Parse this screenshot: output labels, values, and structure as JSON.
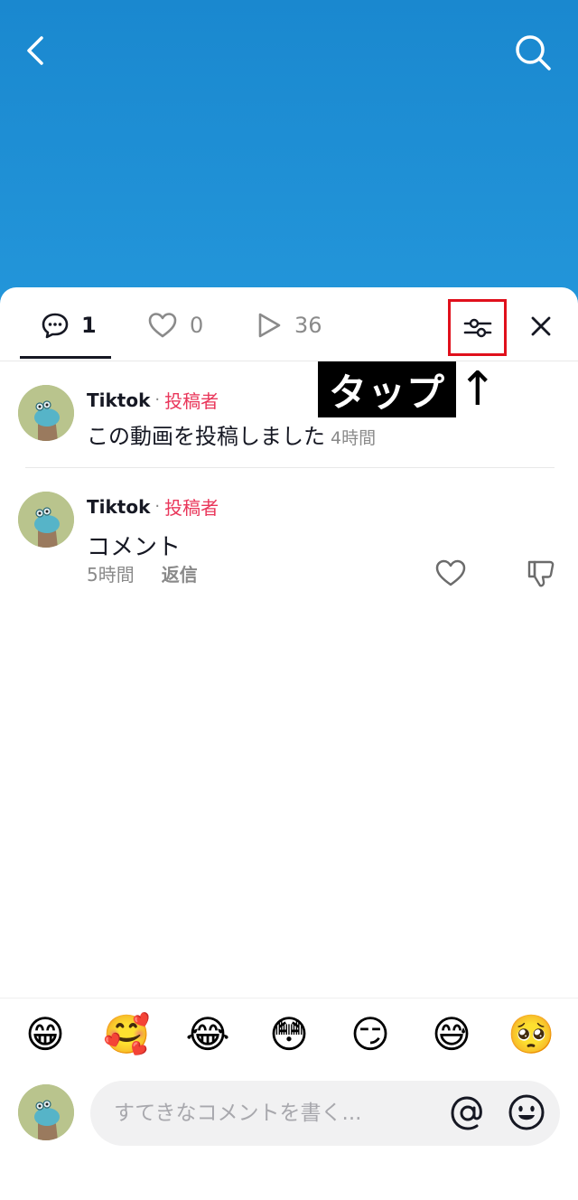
{
  "header": {
    "back_icon": "chevron-left-icon",
    "search_icon": "search-icon"
  },
  "tabs": [
    {
      "icon": "comment-icon",
      "count": "1",
      "active": true
    },
    {
      "icon": "heart-icon",
      "count": "0",
      "active": false
    },
    {
      "icon": "play-icon",
      "count": "36",
      "active": false
    }
  ],
  "toolbar": {
    "filter_icon": "sliders-icon",
    "close_icon": "close-icon"
  },
  "annotation": {
    "label": "タップ",
    "arrow": "↑"
  },
  "comments": [
    {
      "username": "Tiktok",
      "badge": "投稿者",
      "text": "この動画を投稿しました",
      "time": "4時間"
    },
    {
      "username": "Tiktok",
      "badge": "投稿者",
      "text": "コメント",
      "time": "5時間",
      "reply_label": "返信"
    }
  ],
  "emojis": [
    "😁",
    "🥰",
    "😂",
    "😳",
    "😏",
    "😅",
    "🥺"
  ],
  "composer": {
    "placeholder": "すてきなコメントを書く...",
    "mention_icon": "at-icon",
    "emoji_icon": "emoji-face-icon"
  },
  "colors": {
    "accent": "#e9365a",
    "highlight_box": "#e0101c",
    "bg_top": "#1a88cf"
  }
}
